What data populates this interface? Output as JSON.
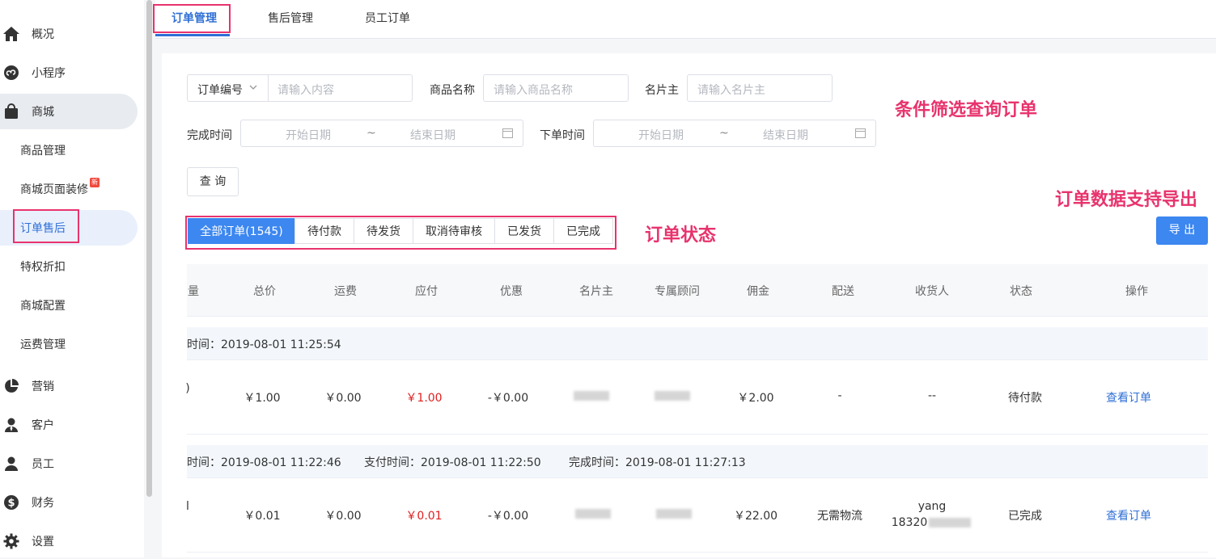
{
  "sidebar": {
    "items": [
      {
        "label": "概况",
        "icon": "home-icon"
      },
      {
        "label": "小程序",
        "icon": "miniprogram-icon"
      },
      {
        "label": "商城",
        "icon": "shopping-bag-icon"
      },
      {
        "label": "营销",
        "icon": "pie-chart-icon"
      },
      {
        "label": "客户",
        "icon": "customer-icon"
      },
      {
        "label": "员工",
        "icon": "user-icon"
      },
      {
        "label": "财务",
        "icon": "dollar-icon"
      },
      {
        "label": "设置",
        "icon": "gear-icon"
      }
    ],
    "sub_items": [
      "商品管理",
      "商城页面装修",
      "订单售后",
      "特权折扣",
      "商城配置",
      "运费管理"
    ],
    "new_badge": "新"
  },
  "top_tabs": [
    "订单管理",
    "售后管理",
    "员工订单"
  ],
  "filters": {
    "order_select": "订单编号",
    "order_placeholder": "请输入内容",
    "product_label": "商品名称",
    "product_placeholder": "请输入商品名称",
    "card_owner_label": "名片主",
    "card_owner_placeholder": "请输入名片主",
    "complete_time_label": "完成时间",
    "order_time_label": "下单时间",
    "start_date": "开始日期",
    "end_date": "结束日期",
    "range_sep": "~",
    "query_button": "查 询"
  },
  "status_tabs": [
    "全部订单(1545)",
    "待付款",
    "待发货",
    "取消待审核",
    "已发货",
    "已完成"
  ],
  "export_button": "导 出",
  "table": {
    "headers": [
      "量",
      "总价",
      "运费",
      "应付",
      "优惠",
      "名片主",
      "专属顾问",
      "佣金",
      "配送",
      "收货人",
      "状态",
      "操作"
    ],
    "groups": [
      {
        "info": "时间：2019-08-01 11:25:54",
        "row": {
          "col0": ")",
          "total": "￥1.00",
          "freight": "￥0.00",
          "payable": "￥1.00",
          "discount": "-￥0.00",
          "commission": "￥2.00",
          "delivery": "-",
          "receiver": "--",
          "status": "待付款",
          "action": "查看订单"
        }
      },
      {
        "info": "时间：2019-08-01 11:22:46",
        "pay_time": "支付时间：2019-08-01 11:22:50",
        "done_time": "完成时间：2019-08-01 11:27:13",
        "row": {
          "col0": "l",
          "total": "￥0.01",
          "freight": "￥0.00",
          "payable": "￥0.01",
          "discount": "-￥0.00",
          "commission": "￥22.00",
          "delivery": "无需物流",
          "receiver": "yang",
          "receiver_phone": "18320",
          "status": "已完成",
          "action": "查看订单"
        }
      }
    ]
  },
  "annotations": {
    "filter_note": "条件筛选查询订单",
    "status_note": "订单状态",
    "export_note": "订单数据支持导出"
  },
  "colors": {
    "primary": "#3c87f0",
    "annotation": "#e8336d",
    "price_red": "#e02020"
  }
}
